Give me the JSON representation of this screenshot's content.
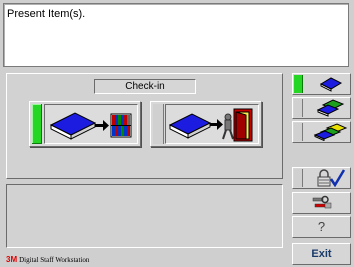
{
  "message": {
    "text": "Present Item(s)."
  },
  "checkin_panel": {
    "title": "Check-in"
  },
  "brand": {
    "mark": "3M",
    "text": "Digital Staff Workstation"
  },
  "side_buttons": {
    "exit_label": "Exit",
    "help_label": "?"
  },
  "colors": {
    "indicator_active": "#25d625",
    "book_blue": "#1c1ce0",
    "brand_red": "#e20000"
  },
  "icons": {
    "checkin": "book-to-shelf-icon",
    "checkout": "book-to-exit-icon",
    "mode_single": "blue-book-icon",
    "mode_multi": "green-blue-books-icon",
    "mode_stack": "multicolor-books-icon",
    "lock": "padlock-check-icon",
    "tools": "wrench-icon"
  }
}
